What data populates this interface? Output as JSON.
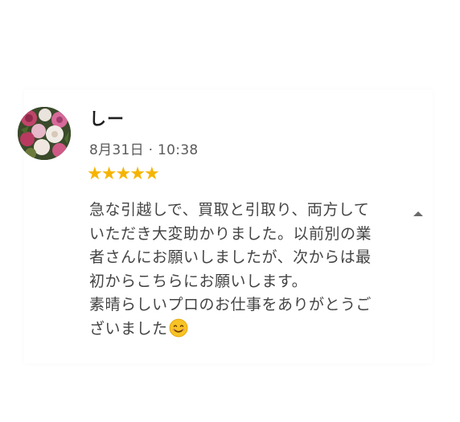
{
  "review": {
    "reviewer_name": "しー",
    "date_text": "8月31日 · 10:38",
    "rating": 5,
    "stars": [
      "★",
      "★",
      "★",
      "★",
      "★"
    ],
    "text_lines": [
      "急な引越しで、買取と引取り、両方して",
      "いただき大変助かりました。以前別の業",
      "者さんにお願いしましたが、次からは最",
      "初からこちらにお願いします。",
      "素晴らしいプロのお仕事をありがとうご",
      "ざいました"
    ],
    "emoji_icon": "smiling-face-icon",
    "collapse_icon": "chevron-up-icon",
    "colors": {
      "star": "#f5b400",
      "text": "#444444",
      "name": "#1f1f1f"
    }
  }
}
